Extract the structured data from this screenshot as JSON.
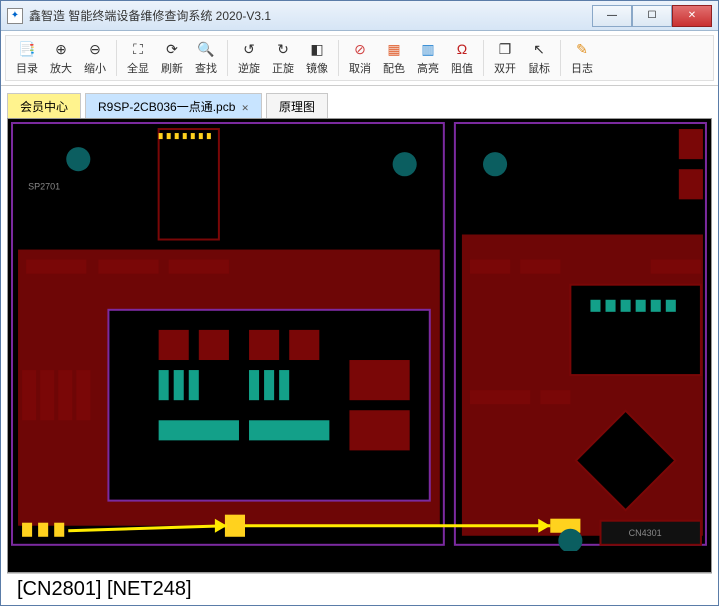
{
  "window": {
    "title": "鑫智造 智能终端设备维修查询系统 2020-V3.1",
    "app_icon_glyph": "✦"
  },
  "toolbar": {
    "items": [
      {
        "label": "目录",
        "glyph": "📑",
        "color": "#e09020"
      },
      {
        "label": "放大",
        "glyph": "⊕",
        "color": "#333"
      },
      {
        "label": "缩小",
        "glyph": "⊖",
        "color": "#333"
      },
      {
        "sep": true
      },
      {
        "label": "全显",
        "glyph": "⛶",
        "color": "#333"
      },
      {
        "label": "刷新",
        "glyph": "⟳",
        "color": "#333"
      },
      {
        "label": "查找",
        "glyph": "🔍",
        "color": "#333"
      },
      {
        "sep": true
      },
      {
        "label": "逆旋",
        "glyph": "↺",
        "color": "#333"
      },
      {
        "label": "正旋",
        "glyph": "↻",
        "color": "#333"
      },
      {
        "label": "镜像",
        "glyph": "◧",
        "color": "#333"
      },
      {
        "sep": true
      },
      {
        "label": "取消",
        "glyph": "⊘",
        "color": "#d04040"
      },
      {
        "label": "配色",
        "glyph": "▦",
        "color": "#e06030"
      },
      {
        "label": "高亮",
        "glyph": "▥",
        "color": "#2080d0"
      },
      {
        "label": "阻值",
        "glyph": "Ω",
        "color": "#c02020"
      },
      {
        "sep": true
      },
      {
        "label": "双开",
        "glyph": "❐",
        "color": "#333"
      },
      {
        "label": "鼠标",
        "glyph": "↖",
        "color": "#333"
      },
      {
        "sep": true
      },
      {
        "label": "日志",
        "glyph": "✎",
        "color": "#e09020"
      }
    ]
  },
  "tabs": [
    {
      "label": "会员中心",
      "class_hint": "yellow"
    },
    {
      "label": "R9SP-2CB036一点通.pcb",
      "class_hint": "active",
      "closable": true
    },
    {
      "label": "原理图",
      "class_hint": ""
    }
  ],
  "pcb": {
    "labels": {
      "sp2701": "SP2701",
      "cn4301": "CN4301"
    }
  },
  "status": {
    "text": "[CN2801] [NET248]"
  }
}
